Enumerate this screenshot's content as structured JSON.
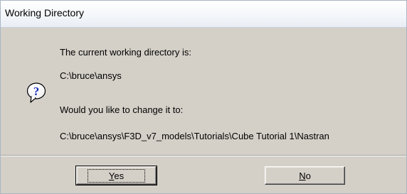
{
  "window": {
    "title": "Working Directory"
  },
  "dialog": {
    "icon": "question-icon",
    "message_line_1": "The current working directory is:",
    "current_directory": "C:\\bruce\\ansys",
    "message_line_2": "Would you like to change it to:",
    "new_directory": "C:\\bruce\\ansys\\F3D_v7_models\\Tutorials\\Cube Tutorial 1\\Nastran"
  },
  "buttons": {
    "yes": {
      "mnemonic": "Y",
      "rest": "es",
      "label": "Yes"
    },
    "no": {
      "mnemonic": "N",
      "rest": "o",
      "label": "No"
    }
  },
  "colors": {
    "dialog_face": "#d4d0c8",
    "icon_blue": "#1a2fb8",
    "titlebar_top": "#ffffff",
    "titlebar_bottom": "#e9eef5"
  }
}
